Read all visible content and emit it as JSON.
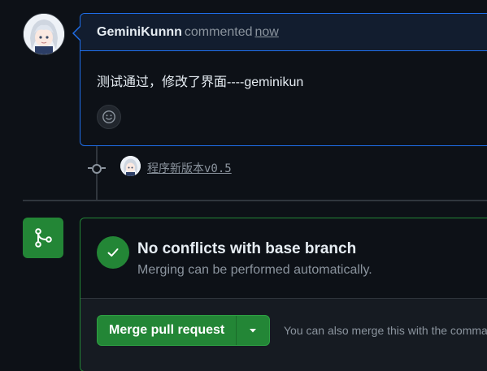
{
  "comment": {
    "author": "GeminiKunnn",
    "action": "commented",
    "time": "now",
    "body": "测试通过，修改了界面----geminikun"
  },
  "commit": {
    "title": "程序新版本v0.5"
  },
  "merge": {
    "title": "No conflicts with base branch",
    "subtitle": "Merging can be performed automatically.",
    "button_label": "Merge pull request",
    "hint": "You can also merge this with the command line."
  },
  "colors": {
    "background": "#0d1117",
    "accent_blue": "#1f6feb",
    "success_green": "#238636",
    "muted_text": "#8b949e"
  },
  "icons": {
    "emoji": "smiley-icon",
    "commit": "git-commit-icon",
    "merge": "git-merge-icon",
    "check": "check-icon",
    "caret": "triangle-down-icon"
  }
}
